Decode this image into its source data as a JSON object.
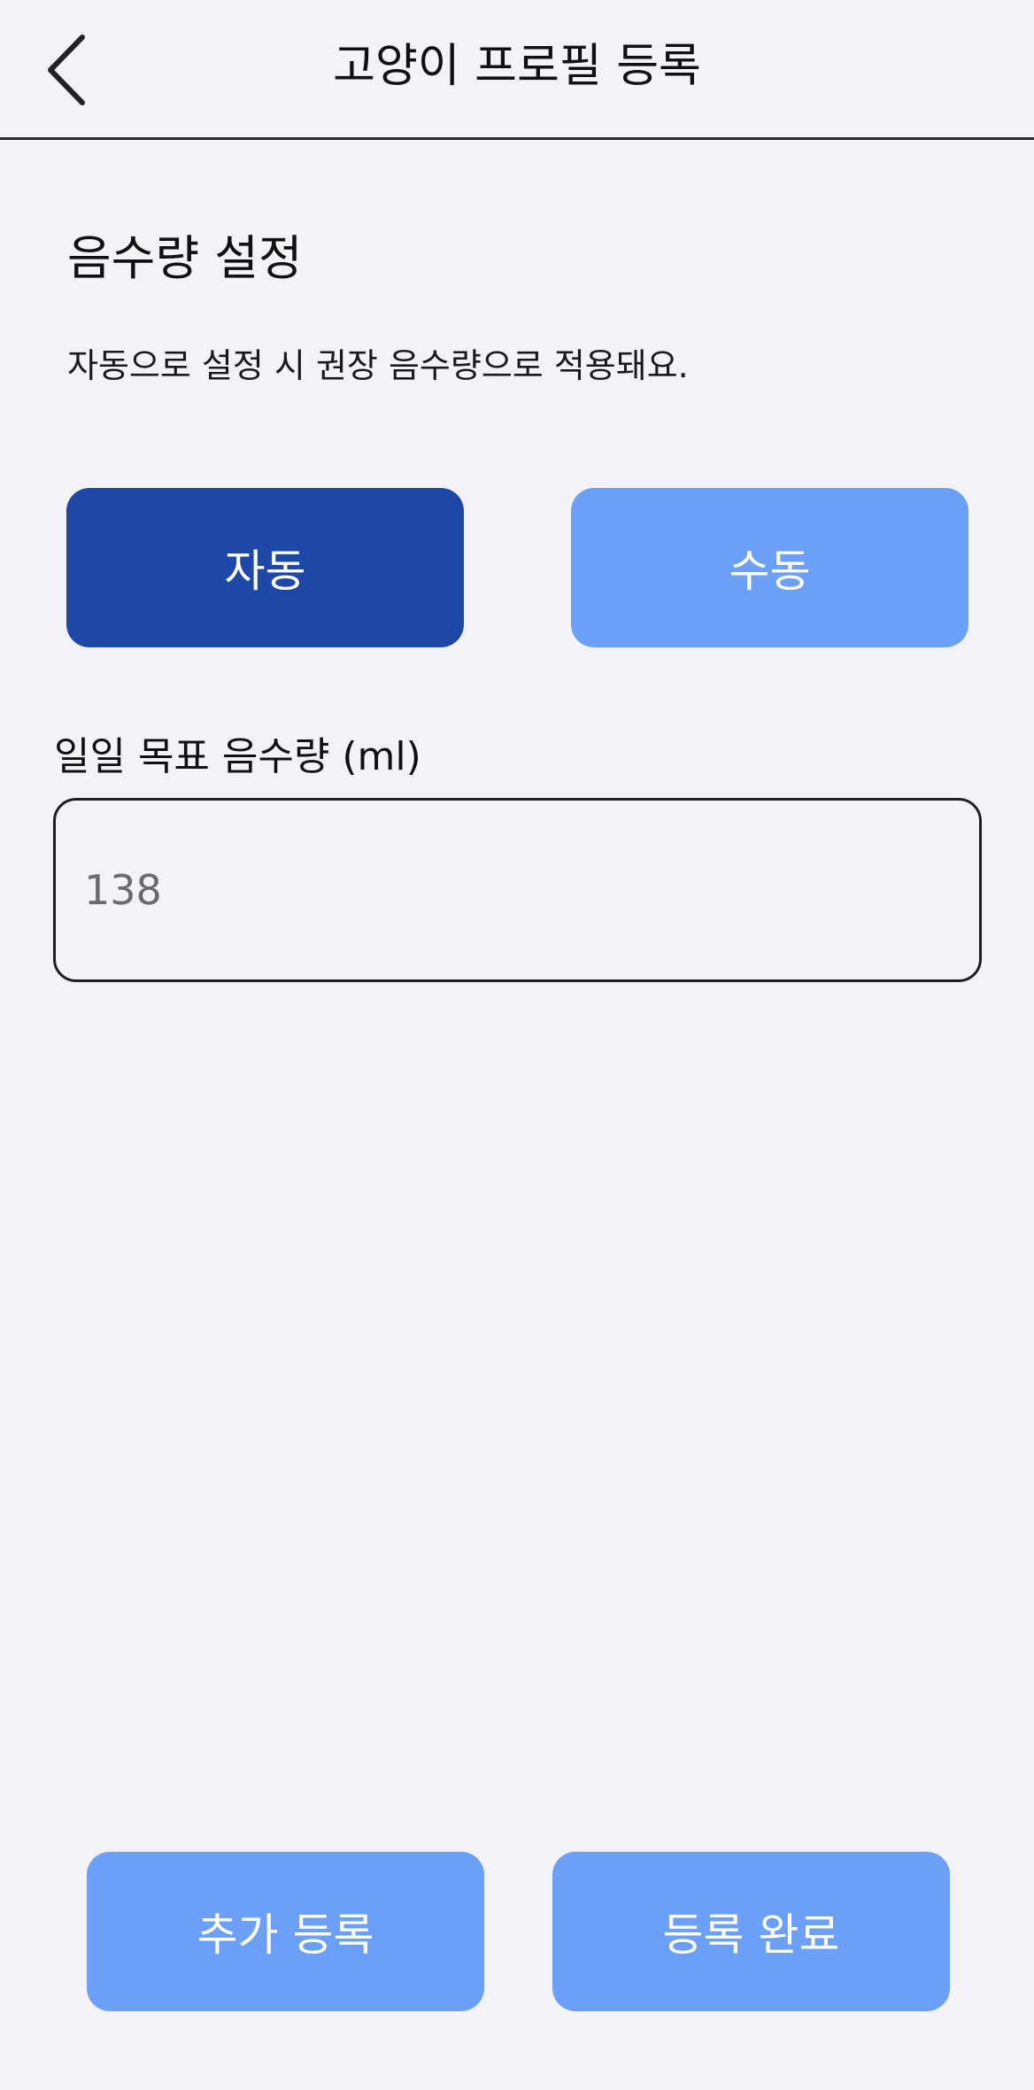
{
  "header": {
    "title": "고양이 프로필 등록",
    "back_icon": "chevron-left-icon"
  },
  "section": {
    "title": "음수량 설정",
    "description": "자동으로 설정 시 권장 음수량으로 적용돼요."
  },
  "mode_toggle": {
    "auto_label": "자동",
    "manual_label": "수동",
    "selected": "자동"
  },
  "goal_field": {
    "label": "일일 목표 음수량 (ml)",
    "value": "",
    "placeholder": "138"
  },
  "footer": {
    "add_label": "추가 등록",
    "done_label": "등록 완료"
  },
  "colors": {
    "background": "#f3f3f7",
    "selected_button": "#1e48a8",
    "unselected_button": "#6c9ff8",
    "text": "#111111"
  }
}
